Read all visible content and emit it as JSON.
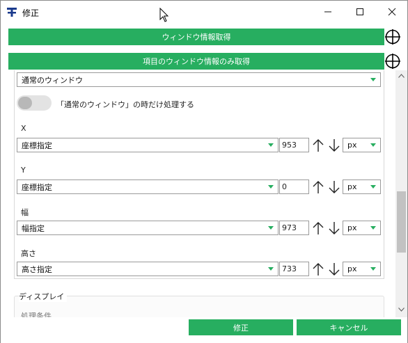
{
  "window": {
    "title": "修正",
    "minimize": "—",
    "maximize": "☐",
    "close": "✕"
  },
  "actions": {
    "get_window_info": "ウィンドウ情報取得",
    "get_item_window_info": "項目のウィンドウ情報のみ取得"
  },
  "form": {
    "window_state": "通常のウィンドウ",
    "toggle_label": "「通常のウィンドウ」の時だけ処理する",
    "toggle_on": false,
    "x": {
      "label": "X",
      "mode": "座標指定",
      "value": "953",
      "unit": "px"
    },
    "y": {
      "label": "Y",
      "mode": "座標指定",
      "value": "0",
      "unit": "px"
    },
    "width": {
      "label": "幅",
      "mode": "幅指定",
      "value": "973",
      "unit": "px"
    },
    "height": {
      "label": "高さ",
      "mode": "高さ指定",
      "value": "733",
      "unit": "px"
    },
    "display_section": "ディスプレイ",
    "cut_off_label": "処理条件"
  },
  "footer": {
    "ok": "修正",
    "cancel": "キャンセル"
  },
  "colors": {
    "accent": "#27ae60",
    "border": "#9a9a9a",
    "app_icon": "#1a3a8c"
  }
}
